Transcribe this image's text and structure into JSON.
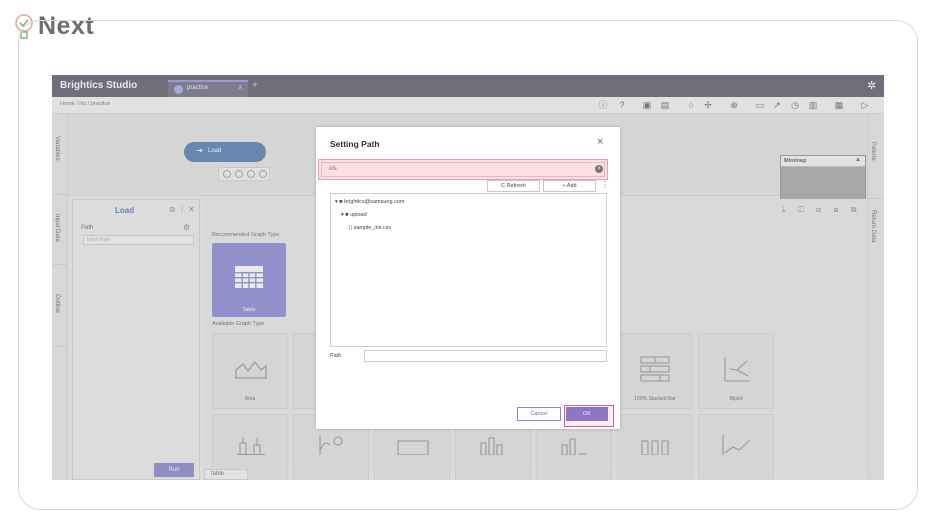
{
  "slide": {
    "heading": "Next"
  },
  "app": {
    "name": "Brightics Studio",
    "tab_label": "practice",
    "tab_close": "×",
    "tab_add": "+",
    "breadcrumb": "Home  /  iris  /  practice"
  },
  "left_rail": [
    "Variables",
    "Input Data",
    "Outline"
  ],
  "right_rail": [
    "Palette",
    "Return Data"
  ],
  "canvas": {
    "node_label": "Load",
    "minimap_label": "Minimap"
  },
  "props_panel": {
    "title": "Load",
    "path_label": "Path",
    "path_placeholder": "Input Path",
    "run_label": "Run"
  },
  "viz": {
    "recommended_label": "Recommended Graph Type",
    "available_label": "Available Graph Type",
    "table_label": "Table",
    "cards": [
      "Area",
      "100% Stacked Bar",
      "Biplot"
    ],
    "bottom_tab": "table"
  },
  "dialog": {
    "title": "Setting Path",
    "close": "×",
    "search_value": "iris",
    "refresh_label": "C Refresh",
    "add_label": "+ Add",
    "tree": [
      {
        "label": "brightics@samsung.com",
        "depth": 0,
        "kind": "folder"
      },
      {
        "label": "upload",
        "depth": 1,
        "kind": "folder"
      },
      {
        "label": "sample_iris.csv",
        "depth": 2,
        "kind": "file"
      }
    ],
    "path_label": "Path",
    "cancel_label": "Cancel",
    "ok_label": "OK"
  },
  "colors": {
    "titlebar": "#4a4a5c",
    "accent": "#6d68c6",
    "highlight": "#e8a0b0"
  }
}
